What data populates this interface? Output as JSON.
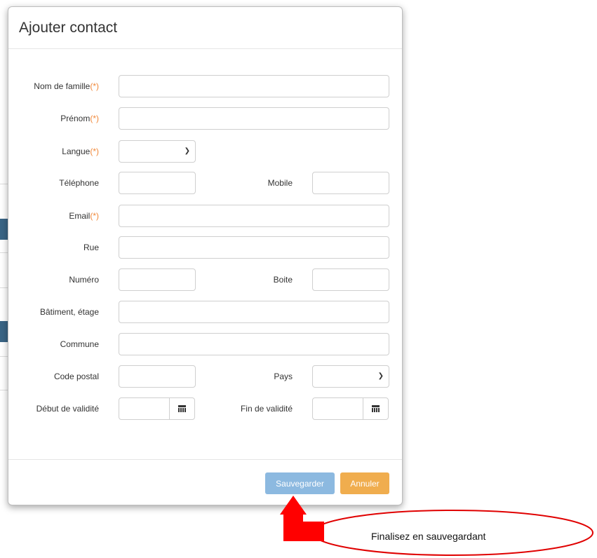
{
  "modal": {
    "title": "Ajouter contact",
    "required_marker": "(*)",
    "fields": {
      "nom_de_famille": {
        "label": "Nom de famille",
        "value": ""
      },
      "prenom": {
        "label": "Prénom",
        "value": ""
      },
      "langue": {
        "label": "Langue",
        "value": ""
      },
      "telephone": {
        "label": "Téléphone",
        "value": ""
      },
      "mobile": {
        "label": "Mobile",
        "value": ""
      },
      "email": {
        "label": "Email",
        "value": ""
      },
      "rue": {
        "label": "Rue",
        "value": ""
      },
      "numero": {
        "label": "Numéro",
        "value": ""
      },
      "boite": {
        "label": "Boite",
        "value": ""
      },
      "batiment": {
        "label": "Bâtiment, étage",
        "value": ""
      },
      "commune": {
        "label": "Commune",
        "value": ""
      },
      "code_postal": {
        "label": "Code postal",
        "value": ""
      },
      "pays": {
        "label": "Pays",
        "value": ""
      },
      "debut_validite": {
        "label": "Début de validité",
        "value": ""
      },
      "fin_validite": {
        "label": "Fin de validité",
        "value": ""
      }
    },
    "buttons": {
      "save_label": "Sauvegarder",
      "cancel_label": "Annuler"
    }
  },
  "annotation": {
    "callout_text": "Finalisez en sauvegardant",
    "arrow_color": "#ff0000",
    "ellipse_color": "#e00000"
  },
  "colors": {
    "required_marker": "#f0883a",
    "save_button": "#8cb9e0",
    "cancel_button": "#f0ad4e"
  },
  "icons": {
    "calendar": "calendar-icon",
    "select": "chevron-down-icon"
  }
}
